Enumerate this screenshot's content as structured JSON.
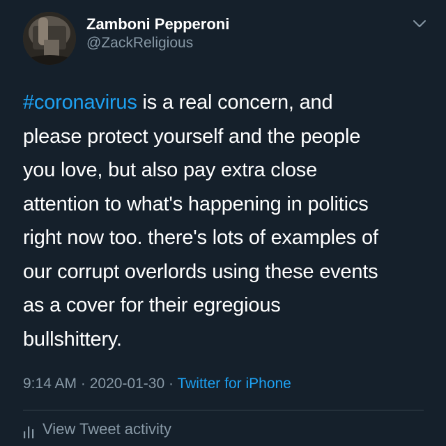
{
  "author": {
    "display_name": "Zamboni Pepperoni",
    "handle": "@ZackReligious",
    "avatar_icon": "profile-photo"
  },
  "tweet": {
    "hashtag": "#coronavirus",
    "line1_rest": " is a real concern, and",
    "lines": [
      "please protect yourself and the people",
      "you love, but also pay extra close",
      "attention to what's happening in politics",
      "right now too. there's lots of examples of",
      "our corrupt overlords using these events",
      "as a cover for their egregious",
      "bullshittery."
    ]
  },
  "meta": {
    "time": "9:14 AM",
    "separator1": " · ",
    "date": "2020-01-30",
    "separator2": " · ",
    "source": "Twitter for iPhone"
  },
  "activity": {
    "label": "View Tweet activity",
    "icon": "bar-chart-icon"
  },
  "colors": {
    "background": "#15202b",
    "accent": "#1da1f2",
    "secondary_text": "#8899a6",
    "divider": "#38444d"
  }
}
